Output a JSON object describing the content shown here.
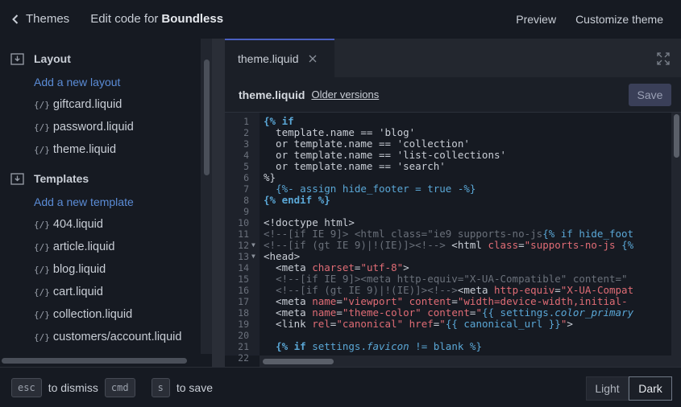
{
  "topbar": {
    "back_label": "Themes",
    "title_prefix": "Edit code for",
    "theme_name": "Boundless",
    "preview": "Preview",
    "customize": "Customize theme"
  },
  "sidebar": {
    "layout_heading": "Layout",
    "add_layout": "Add a new layout",
    "layout_files": [
      "giftcard.liquid",
      "password.liquid",
      "theme.liquid"
    ],
    "templates_heading": "Templates",
    "add_template": "Add a new template",
    "template_files": [
      "404.liquid",
      "article.liquid",
      "blog.liquid",
      "cart.liquid",
      "collection.liquid",
      "customers/account.liquid"
    ]
  },
  "editor": {
    "tab_label": "theme.liquid",
    "file_name": "theme.liquid",
    "older_versions": "Older versions",
    "save": "Save",
    "lines": [
      {
        "n": "1",
        "html": "<span class='kw'>{% if</span>"
      },
      {
        "n": "2",
        "html": "  template.name == 'blog'"
      },
      {
        "n": "3",
        "html": "  or template.name == 'collection'"
      },
      {
        "n": "4",
        "html": "  or template.name == 'list-collections'"
      },
      {
        "n": "5",
        "html": "  or template.name == 'search'"
      },
      {
        "n": "6",
        "html": "%}"
      },
      {
        "n": "7",
        "html": "  <span class='lq'>{%- assign hide_footer = true -%}</span>"
      },
      {
        "n": "8",
        "html": "<span class='kw'>{% endif %}</span>"
      },
      {
        "n": "9",
        "html": ""
      },
      {
        "n": "10",
        "html": "&lt;!doctype html&gt;"
      },
      {
        "n": "11",
        "html": "<span class='cm'>&lt;!--[if IE 9]&gt; &lt;html class=\"ie9 supports-no-js</span><span class='lq'>{% if hide_foot</span>"
      },
      {
        "n": "12",
        "fold": true,
        "html": "<span class='cm'>&lt;!--[if (gt IE 9)|!(IE)]&gt;&lt;!--&gt;</span> &lt;html <span class='at'>class</span>=<span class='av'>\"supports-no-js</span> <span class='lq'>{%</span>"
      },
      {
        "n": "13",
        "fold": true,
        "html": "&lt;head&gt;"
      },
      {
        "n": "14",
        "html": "  &lt;meta <span class='at'>charset</span>=<span class='av'>\"utf-8\"</span>&gt;"
      },
      {
        "n": "15",
        "html": "  <span class='cm'>&lt;!--[if IE 9]&gt;&lt;meta http-equiv=\"X-UA-Compatible\" content=\"</span>"
      },
      {
        "n": "16",
        "html": "  <span class='cm'>&lt;!--[if (gt IE 9)|!(IE)]&gt;&lt;!--&gt;</span>&lt;meta <span class='at'>http-equiv</span>=<span class='av'>\"X-UA-Compat</span>"
      },
      {
        "n": "17",
        "html": "  &lt;meta <span class='at'>name</span>=<span class='av'>\"viewport\"</span> <span class='at'>content</span>=<span class='av'>\"width=device-width,initial-</span>"
      },
      {
        "n": "18",
        "html": "  &lt;meta <span class='at'>name</span>=<span class='av'>\"theme-color\"</span> <span class='at'>content</span>=<span class='av'>\"</span><span class='lq'>{{ settings.<span class='it'>color_primary</span></span>"
      },
      {
        "n": "19",
        "html": "  &lt;link <span class='at'>rel</span>=<span class='av'>\"canonical\"</span> <span class='at'>href</span>=<span class='av'>\"</span><span class='lq'>{{ canonical_url }}</span><span class='av'>\"</span>&gt;"
      },
      {
        "n": "20",
        "html": ""
      },
      {
        "n": "21",
        "html": "  <span class='kw'>{% if</span> <span class='lq'>settings.<span class='it'>favicon</span> != blank %}</span>"
      },
      {
        "n": "22",
        "html": ""
      }
    ]
  },
  "footer": {
    "key_esc": "esc",
    "dismiss": "to dismiss",
    "key_cmd": "cmd",
    "key_s": "s",
    "save_hint": "to save",
    "light": "Light",
    "dark": "Dark"
  },
  "colors": {
    "accent": "#5b8cd6",
    "tab_indicator": "#4a5fc1"
  }
}
